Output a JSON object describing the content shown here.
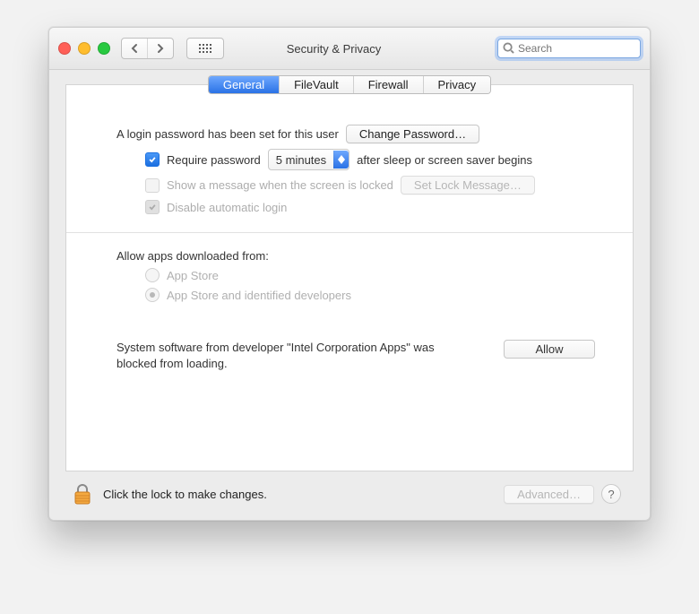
{
  "window": {
    "title": "Security & Privacy"
  },
  "search": {
    "placeholder": "Search",
    "value": ""
  },
  "tabs": {
    "general": "General",
    "filevault": "FileVault",
    "firewall": "Firewall",
    "privacy": "Privacy"
  },
  "general": {
    "login_password_set": "A login password has been set for this user",
    "change_password": "Change Password…",
    "require_password_label": "Require password",
    "require_password_delay": "5 minutes",
    "require_password_after": "after sleep or screen saver begins",
    "show_message_label": "Show a message when the screen is locked",
    "set_lock_message": "Set Lock Message…",
    "disable_auto_login": "Disable automatic login",
    "allow_apps_header": "Allow apps downloaded from:",
    "app_store": "App Store",
    "app_store_identified": "App Store and identified developers",
    "blocked_text": "System software from developer \"Intel Corporation Apps\" was blocked from loading.",
    "allow_button": "Allow"
  },
  "footer": {
    "lock_text": "Click the lock to make changes.",
    "advanced": "Advanced…",
    "help": "?"
  }
}
